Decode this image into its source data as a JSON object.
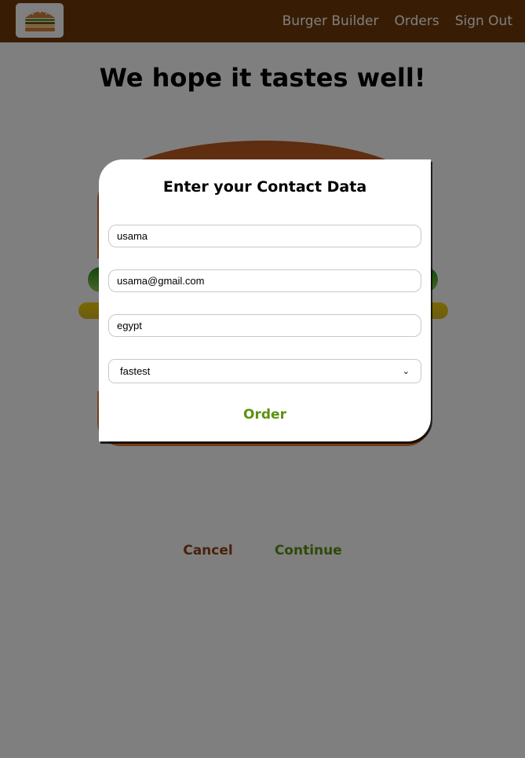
{
  "nav": {
    "logo_alt": "burger-logo",
    "items": [
      {
        "label": "Burger Builder"
      },
      {
        "label": "Orders"
      },
      {
        "label": "Sign Out"
      }
    ]
  },
  "page": {
    "title": "We hope it tastes well!",
    "cancel_label": "Cancel",
    "continue_label": "Continue"
  },
  "modal": {
    "title": "Enter your Contact Data",
    "fields": [
      {
        "name": "name",
        "value": "usama"
      },
      {
        "name": "email",
        "value": "usama@gmail.com"
      },
      {
        "name": "country",
        "value": "egypt"
      }
    ],
    "delivery_method": {
      "selected": "fastest"
    },
    "order_label": "Order"
  },
  "colors": {
    "toolbar": "#703b09",
    "success": "#5c9210",
    "danger": "#944317"
  }
}
